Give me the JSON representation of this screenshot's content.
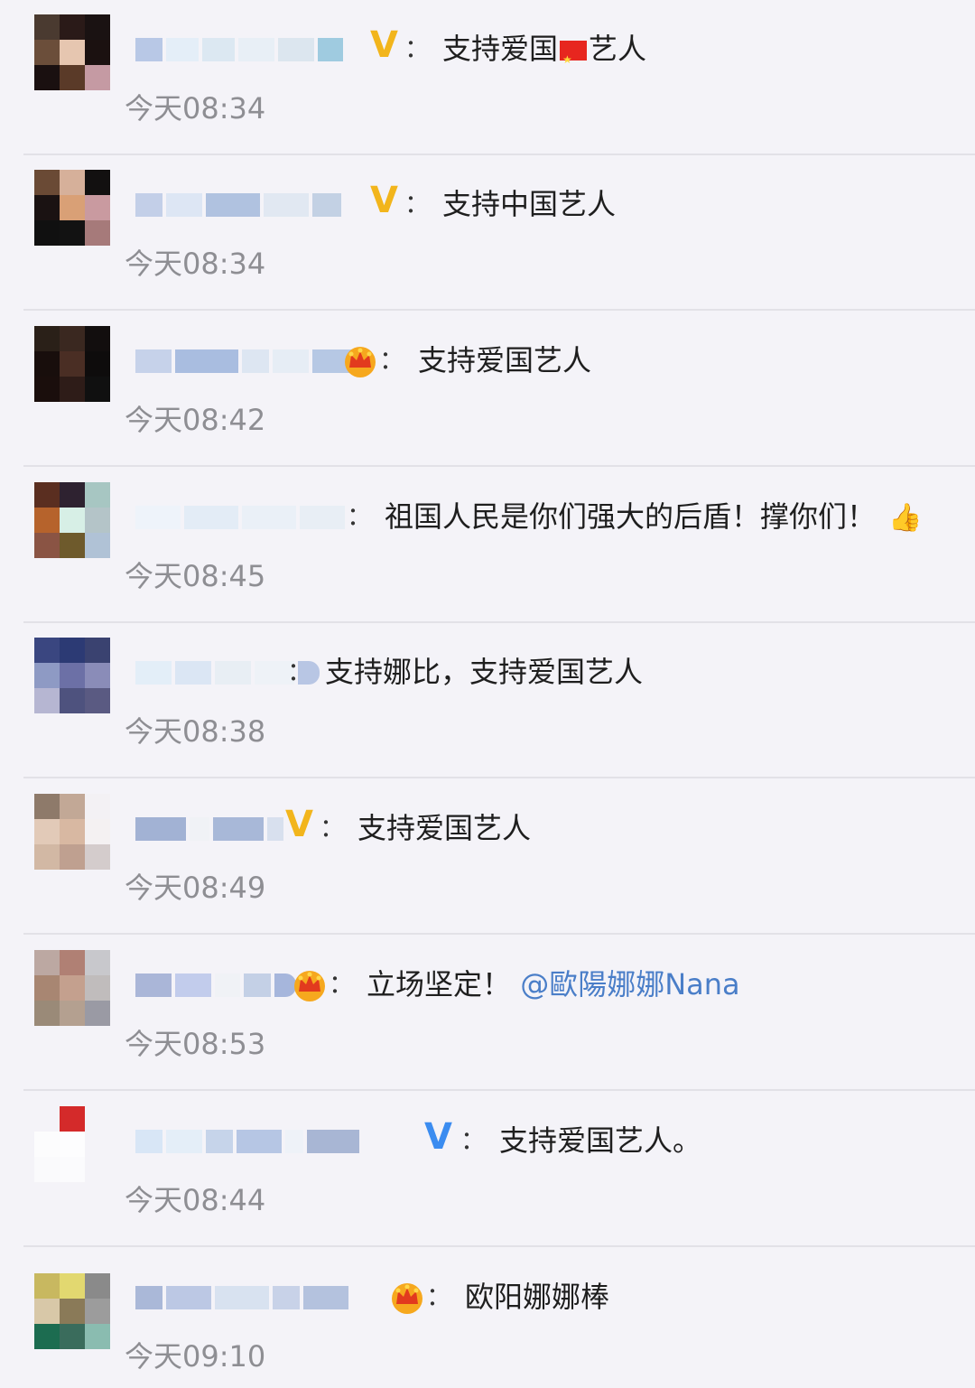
{
  "comments": [
    {
      "badge": "v-gold",
      "text": "支持爱国",
      "text_after_flag": "艺人",
      "time": "今天08:34",
      "has_flag": true
    },
    {
      "badge": "v-gold",
      "text": "支持中国艺人",
      "time": "今天08:34"
    },
    {
      "badge": "crown",
      "text": "支持爱国艺人",
      "time": "今天08:42"
    },
    {
      "badge": "none",
      "text": "祖国人民是你们强大的后盾！撑你们！",
      "time": "今天08:45",
      "emoji": "thumbs-up"
    },
    {
      "badge": "none",
      "text": "支持娜比，支持爱国艺人",
      "time": "今天08:38"
    },
    {
      "badge": "v-gold",
      "text": "支持爱国艺人",
      "time": "今天08:49"
    },
    {
      "badge": "crown",
      "text": "立场坚定！",
      "mention": "@歐陽娜娜Nana",
      "time": "今天08:53"
    },
    {
      "badge": "v-blue",
      "text": "支持爱国艺人。",
      "time": "今天08:44"
    },
    {
      "badge": "crown",
      "text": "欧阳娜娜棒",
      "time": "今天09:10"
    }
  ],
  "colon": "：",
  "colors": {
    "v_gold": "#f2b51c",
    "v_blue": "#3b8cf0",
    "mention": "#4a7ec8",
    "time": "#8e8e93"
  },
  "icons": {
    "v_label": "V",
    "thumb": "👍"
  }
}
